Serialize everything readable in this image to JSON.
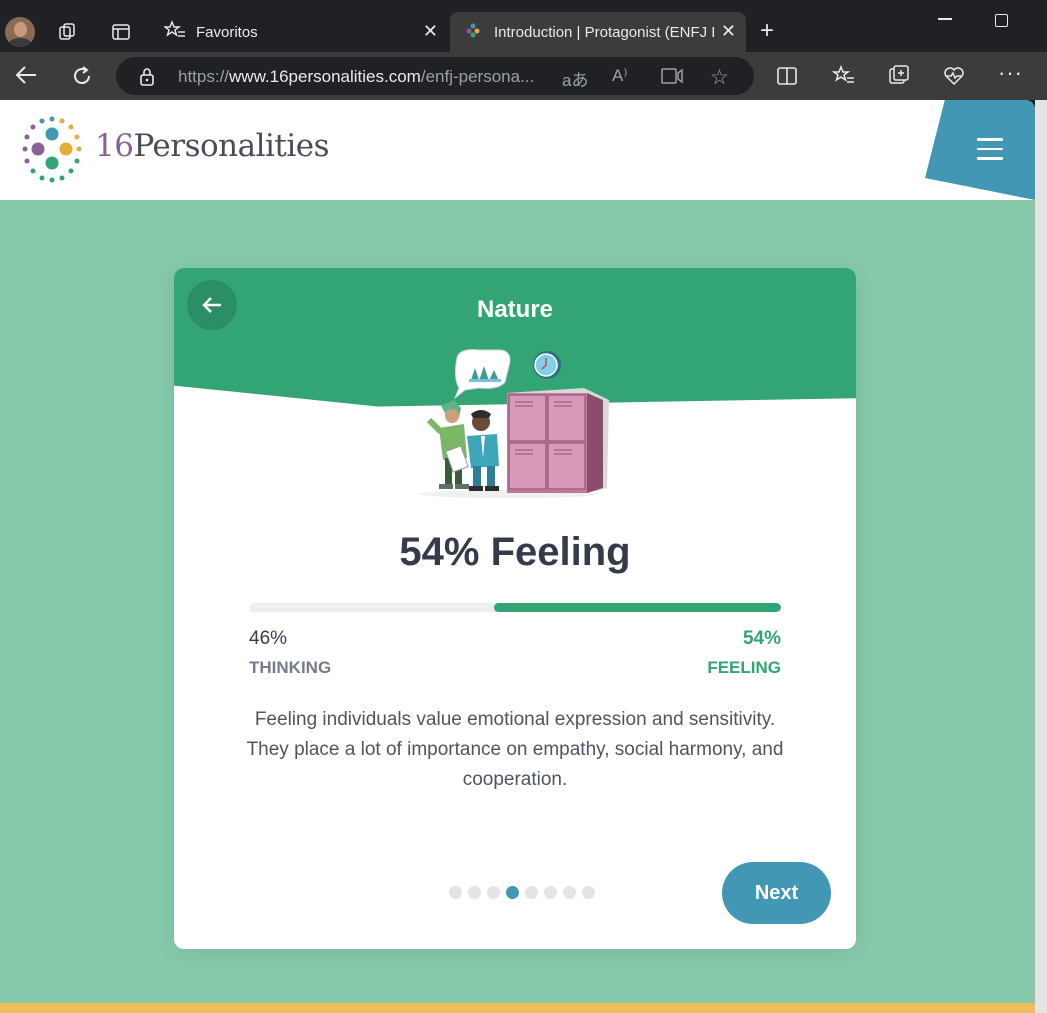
{
  "browser": {
    "tabs": [
      {
        "title": "Favoritos",
        "icon": "star-list-icon"
      },
      {
        "title": "Introduction | Protagonist (ENFJ Pe",
        "icon": "site-favicon-icon"
      }
    ],
    "url_prefix": "https://",
    "url_host": "www.16personalities.com",
    "url_path": "/enfj-persona..."
  },
  "site": {
    "logo_number": "16",
    "logo_word": "Personalities"
  },
  "card": {
    "title": "Nature",
    "score_headline": "54% Feeling",
    "left_percent": "46%",
    "left_label": "THINKING",
    "right_percent": "54%",
    "right_label": "FEELING",
    "fill_fraction": 0.54,
    "description": "Feeling individuals value emotional expression and sensitivity. They place a lot of importance on empathy, social harmony, and cooperation.",
    "next_label": "Next",
    "pagination": {
      "total": 8,
      "active_index": 3
    }
  },
  "colors": {
    "accent_green": "#33a474",
    "accent_blue": "#4298b4",
    "page_bg": "#86c8aa"
  }
}
